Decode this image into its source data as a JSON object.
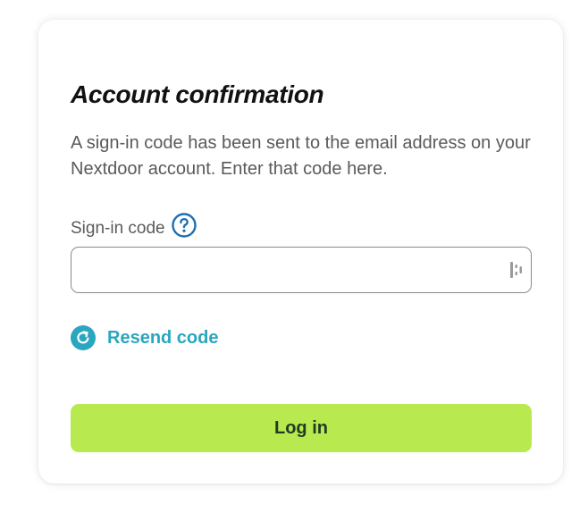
{
  "card": {
    "title": "Account confirmation",
    "description": "A sign-in code has been sent to the email address on your Nextdoor account. Enter that code here."
  },
  "form": {
    "code_label": "Sign-in code",
    "code_value": "",
    "help_icon": "question-circle-icon",
    "input_trailing_icon": "password-manager-icon",
    "resend_label": "Resend code",
    "resend_icon": "refresh-icon",
    "submit_label": "Log in"
  },
  "colors": {
    "accent_teal": "#2aa6bf",
    "help_blue": "#1f6fb0",
    "button_green": "#b8ea50",
    "button_text": "#1f3b22"
  }
}
